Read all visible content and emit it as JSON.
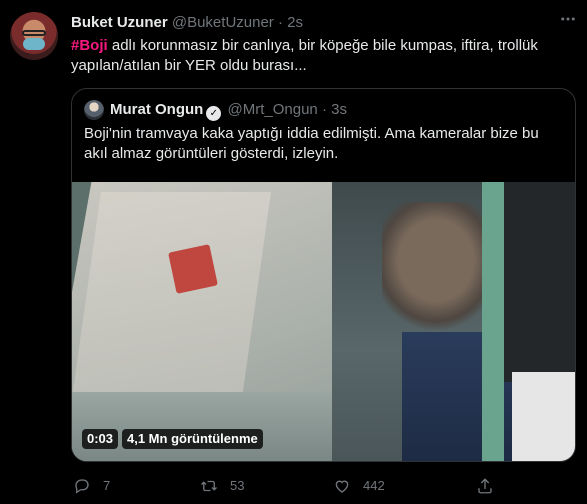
{
  "tweet": {
    "author_name": "Buket Uzuner",
    "author_handle": "@BuketUzuner",
    "separator": "·",
    "time": "2s",
    "hashtag": "#Boji",
    "text_after_hashtag": " adlı korunmasız bir canlıya, bir köpeğe bile kumpas, iftira, trollük yapılan/atılan bir YER oldu burası...",
    "more_icon": "more-horizontal-icon"
  },
  "quoted_tweet": {
    "author_name": "Murat Ongun",
    "verified_icon": "verified-badge-icon",
    "verified_glyph": "✓",
    "author_handle": "@Mrt_Ongun",
    "separator": "·",
    "time": "3s",
    "text": "Boji'nin tramvaya kaka yaptığı iddia edilmişti. Ama kameralar bize bu akıl almaz görüntüleri gösterdi, izleyin.",
    "video": {
      "duration": "0:03",
      "views": "4,1 Mn görüntülenme"
    }
  },
  "actions": {
    "reply": {
      "icon": "reply-icon",
      "count": "7"
    },
    "retweet": {
      "icon": "retweet-icon",
      "count": "53"
    },
    "like": {
      "icon": "heart-icon",
      "count": "442"
    },
    "share": {
      "icon": "share-icon"
    }
  },
  "colors": {
    "background": "#000000",
    "text_primary": "#e7e9ea",
    "text_secondary": "#71767b",
    "hashtag": "#f91880",
    "border": "#2f3336"
  }
}
